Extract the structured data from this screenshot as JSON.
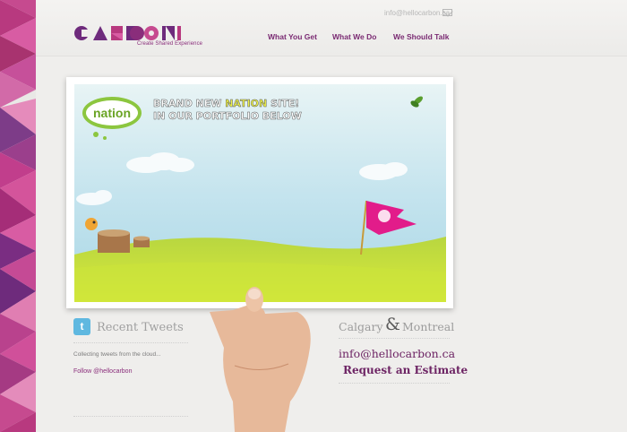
{
  "header": {
    "logo_text": "CARBON",
    "tagline": "Create Shared Experience",
    "contact_email": "info@hellocarbon.ca",
    "nav": [
      {
        "label": "What You Get"
      },
      {
        "label": "What We Do"
      },
      {
        "label": "We Should Talk"
      }
    ]
  },
  "hero": {
    "badge_text": "nation",
    "headline_part1": "BRAND NEW ",
    "headline_highlight": "NATION",
    "headline_part2": " SITE!",
    "headline_line2": "IN OUR PORTFOLIO BELOW"
  },
  "tweets": {
    "title": "Recent Tweets",
    "status": "Collecting tweets from the cloud...",
    "follow": "Follow @hellocarbon"
  },
  "contact": {
    "city1": "Calgary",
    "ampersand": "&",
    "city2": "Montreal",
    "email": "info@hellocarbon.ca",
    "cta": "Request an Estimate"
  },
  "colors": {
    "brand_purple": "#7a2a72",
    "triangle_pink": "#d94f9c",
    "sky": "#bfe2ef",
    "grass": "#b8d640"
  }
}
